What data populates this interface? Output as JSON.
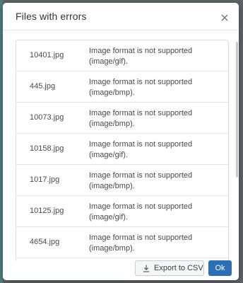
{
  "dialog": {
    "title": "Files with errors",
    "close_icon": "close-icon"
  },
  "errors": [
    {
      "file": "10401.jpg",
      "message": "Image format is not supported (image/gif)."
    },
    {
      "file": "445.jpg",
      "message": "Image format is not supported (image/bmp)."
    },
    {
      "file": "10073.jpg",
      "message": "Image format is not supported (image/bmp)."
    },
    {
      "file": "10158.jpg",
      "message": "Image format is not supported (image/gif)."
    },
    {
      "file": "1017.jpg",
      "message": "Image format is not supported (image/bmp)."
    },
    {
      "file": "10125.jpg",
      "message": "Image format is not supported (image/gif)."
    },
    {
      "file": "4654.jpg",
      "message": "Image format is not supported (image/bmp)."
    }
  ],
  "footer": {
    "export_label": "Export to CSV",
    "export_icon": "download-icon",
    "ok_label": "Ok"
  },
  "colors": {
    "primary": "#2c6fb7",
    "backdrop": "#5f6566"
  }
}
